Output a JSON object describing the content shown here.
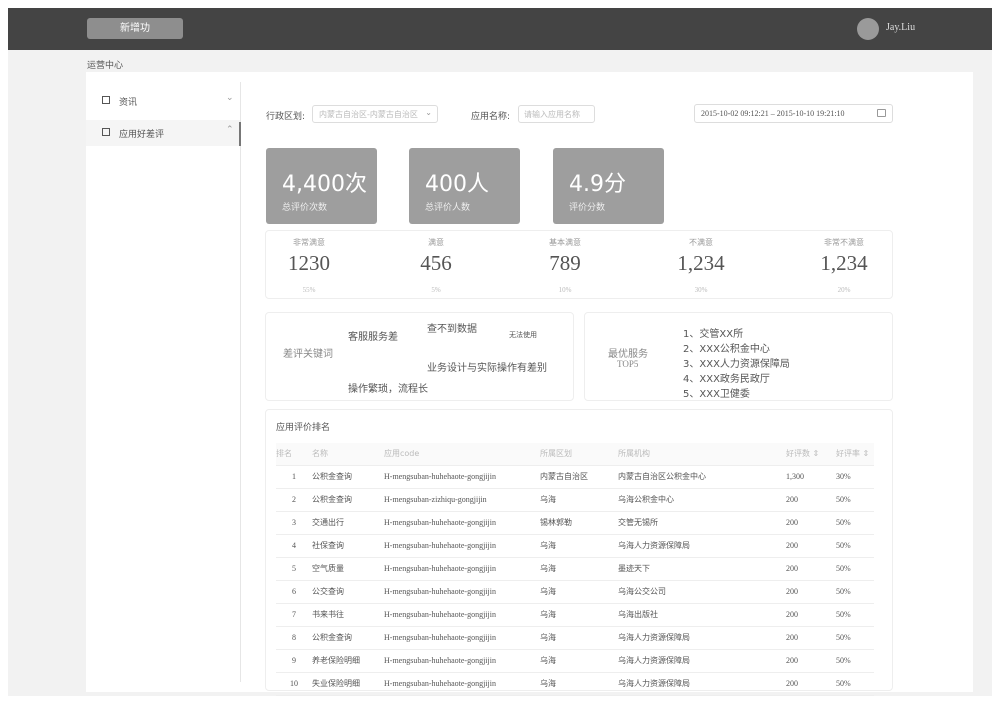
{
  "topbar": {
    "button_label": "新增功",
    "username": "Jay.Liu"
  },
  "breadcrumb": "运营中心",
  "sidebar": {
    "items": [
      {
        "label": "资讯",
        "chevron": "⌄"
      },
      {
        "label": "应用好差评",
        "chevron": "⌃"
      }
    ]
  },
  "filters": {
    "region_label": "行政区划:",
    "region_value": "内蒙古自治区-内蒙古自治区",
    "app_label": "应用名称:",
    "app_placeholder": "请输入应用名称",
    "date_range": "2015-10-02 09:12:21 – 2015-10-10 19:21:10"
  },
  "kpis": [
    {
      "value": "4,400次",
      "label": "总评价次数"
    },
    {
      "value": "400人",
      "label": "总评价人数"
    },
    {
      "value": "4.9分",
      "label": "评价分数"
    }
  ],
  "stats": [
    {
      "title": "非常满意",
      "value": "1230",
      "percent": "55%"
    },
    {
      "title": "满意",
      "value": "456",
      "percent": "5%"
    },
    {
      "title": "基本满意",
      "value": "789",
      "percent": "10%"
    },
    {
      "title": "不满意",
      "value": "1,234",
      "percent": "30%"
    },
    {
      "title": "非常不满意",
      "value": "1,234",
      "percent": "20%"
    }
  ],
  "keywords": {
    "title": "差评关键词",
    "words": [
      "客服服务差",
      "查不到数据",
      "无法使用",
      "业务设计与实际操作有差别",
      "操作繁琐，流程长"
    ]
  },
  "top_services": {
    "title": "最优服务",
    "subtitle": "TOP5",
    "items": [
      "1、交管XX所",
      "2、XXX公积金中心",
      "3、XXX人力资源保障局",
      "4、XXX政务民政厅",
      "5、XXX卫健委"
    ]
  },
  "ranking": {
    "title": "应用评价排名",
    "columns": [
      "排名",
      "名称",
      "应用code",
      "所属区划",
      "所属机构",
      "好评数 ⇕",
      "好评率 ⇕"
    ],
    "rows": [
      [
        "1",
        "公积金查询",
        "H-mengsuban-huhehaote-gongjijin",
        "内蒙古自治区",
        "内蒙古自治区公积金中心",
        "1,300",
        "30%"
      ],
      [
        "2",
        "公积金查询",
        "H-mengsuban-zizhiqu-gongjijin",
        "乌海",
        "乌海公积金中心",
        "200",
        "50%"
      ],
      [
        "3",
        "交通出行",
        "H-mengsuban-huhehaote-gongjijin",
        "锡林郭勒",
        "交管无锡所",
        "200",
        "50%"
      ],
      [
        "4",
        "社保查询",
        "H-mengsuban-huhehaote-gongjijin",
        "乌海",
        "乌海人力资源保障局",
        "200",
        "50%"
      ],
      [
        "5",
        "空气质量",
        "H-mengsuban-huhehaote-gongjijin",
        "乌海",
        "墨迹天下",
        "200",
        "50%"
      ],
      [
        "6",
        "公交查询",
        "H-mengsuban-huhehaote-gongjijin",
        "乌海",
        "乌海公交公司",
        "200",
        "50%"
      ],
      [
        "7",
        "书来书往",
        "H-mengsuban-huhehaote-gongjijin",
        "乌海",
        "乌海出版社",
        "200",
        "50%"
      ],
      [
        "8",
        "公积金查询",
        "H-mengsuban-huhehaote-gongjijin",
        "乌海",
        "乌海人力资源保障局",
        "200",
        "50%"
      ],
      [
        "9",
        "养老保险明细",
        "H-mengsuban-huhehaote-gongjijin",
        "乌海",
        "乌海人力资源保障局",
        "200",
        "50%"
      ],
      [
        "10",
        "失业保险明细",
        "H-mengsuban-huhehaote-gongjijin",
        "乌海",
        "乌海人力资源保障局",
        "200",
        "50%"
      ]
    ]
  }
}
